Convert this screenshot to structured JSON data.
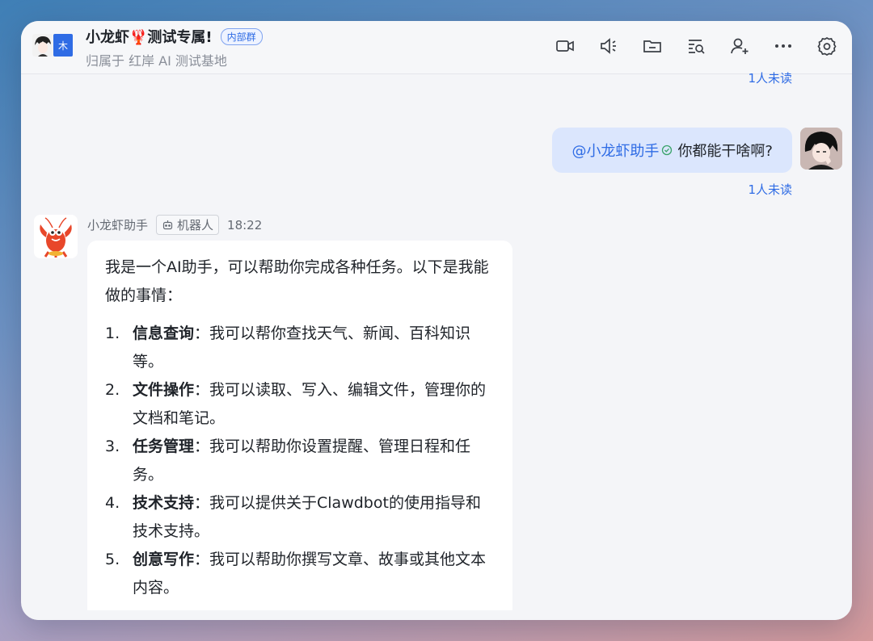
{
  "header": {
    "title": "小龙虾🦞测试专属!",
    "tag": "内部群",
    "subtitle": "归属于 红岸 AI 测试基地",
    "badge_char": "木"
  },
  "toolbar": {
    "icons": [
      "video-call-icon",
      "speaker-icon",
      "folder-icon",
      "search-messages-icon",
      "add-member-icon",
      "more-icon",
      "settings-icon"
    ]
  },
  "chat": {
    "read_top": "1人未读",
    "my_message": {
      "mention": "@小龙虾助手",
      "text": "你都能干啥啊?",
      "read_status": "1人未读"
    },
    "bot": {
      "name": "小龙虾助手",
      "robot_tag": "机器人",
      "time": "18:22",
      "intro": "我是一个AI助手，可以帮助你完成各种任务。以下是我能做的事情：",
      "items": [
        {
          "num": "1.",
          "bold": "信息查询",
          "text": "：我可以帮你查找天气、新闻、百科知识等。"
        },
        {
          "num": "2.",
          "bold": "文件操作",
          "text": "：我可以读取、写入、编辑文件，管理你的文档和笔记。"
        },
        {
          "num": "3.",
          "bold": "任务管理",
          "text": "：我可以帮助你设置提醒、管理日程和任务。"
        },
        {
          "num": "4.",
          "bold": "技术支持",
          "text": "：我可以提供关于Clawdbot的使用指导和技术支持。"
        },
        {
          "num": "5.",
          "bold": "创意写作",
          "text": "：我可以帮助你撰写文章、故事或其他文本内容。"
        }
      ]
    }
  },
  "colors": {
    "accent": "#2f6ce5",
    "my_bubble": "#dbe6fd",
    "window_bg": "#f4f5f8"
  }
}
